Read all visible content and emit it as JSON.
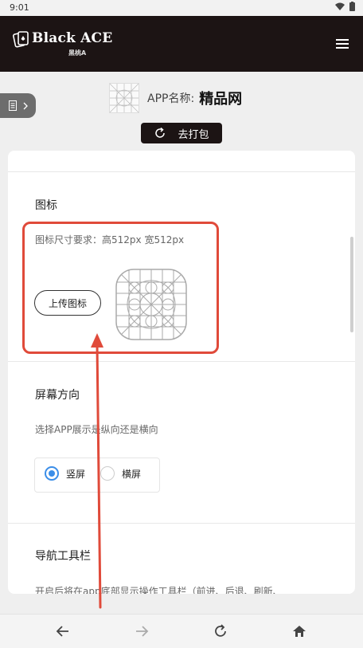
{
  "status": {
    "time": "9:01"
  },
  "header": {
    "logo_title": "Black ACE",
    "logo_sub": "黑桃A"
  },
  "side_tab": {
    "icon": "list-icon",
    "chevron": "chevron-right-icon"
  },
  "app_info": {
    "label": "APP名称:",
    "name": "精品网"
  },
  "pack_button": {
    "label": "去打包",
    "icon": "refresh-icon"
  },
  "icon_section": {
    "title": "图标",
    "requirement": "图标尺寸要求：高512px 宽512px",
    "upload_label": "上传图标"
  },
  "orientation_section": {
    "title": "屏幕方向",
    "description": "选择APP展示是纵向还是横向",
    "options": [
      {
        "label": "竖屏",
        "selected": true
      },
      {
        "label": "横屏",
        "selected": false
      }
    ]
  },
  "toolbar_section": {
    "title": "导航工具栏",
    "description": "开启后将在app底部显示操作工具栏（前进、后退、刷新、"
  },
  "colors": {
    "appbar": "#1c1414",
    "accent": "#3b8ee8",
    "annotation": "#e04a3a"
  },
  "bottom_nav": [
    "back-arrow-icon",
    "forward-arrow-icon",
    "reload-icon",
    "home-icon"
  ]
}
